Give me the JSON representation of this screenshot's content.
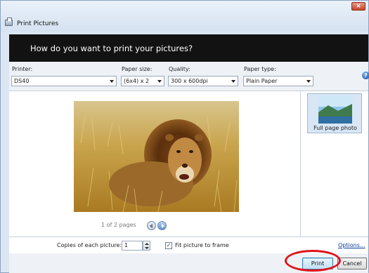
{
  "window": {
    "title": "Print Pictures",
    "close_glyph": "×"
  },
  "banner": {
    "heading": "How do you want to print your pictures?"
  },
  "options": {
    "printer": {
      "label": "Printer:",
      "value": "DS40"
    },
    "paper_size": {
      "label": "Paper size:",
      "value": "(6x4) x 2"
    },
    "quality": {
      "label": "Quality:",
      "value": "300 x 600dpi"
    },
    "paper_type": {
      "label": "Paper type:",
      "value": "Plain Paper"
    },
    "help_glyph": "?"
  },
  "preview": {
    "page_count": "1 of 2 pages"
  },
  "layouts": [
    {
      "label": "Full page photo",
      "selected": true
    }
  ],
  "copies": {
    "label": "Copies of each picture:",
    "value": "1"
  },
  "fit": {
    "label": "Fit picture to frame",
    "checked": true,
    "check_glyph": "✓"
  },
  "options_link": "Options...",
  "buttons": {
    "print": "Print",
    "cancel": "Cancel"
  },
  "colors": {
    "banner": "#121212",
    "annotation_ring": "#e0131b",
    "link": "#0c3f9c"
  }
}
